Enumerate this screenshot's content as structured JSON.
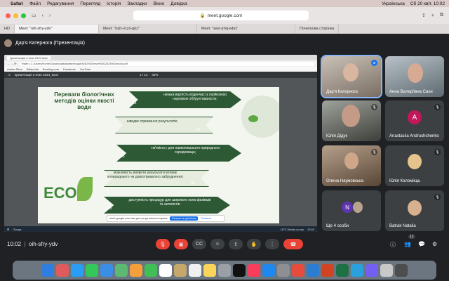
{
  "menubar": {
    "items": [
      "Safari",
      "Файл",
      "Редагування",
      "Перегляд",
      "Історія",
      "Закладки",
      "Вікно",
      "Довідка"
    ],
    "keyboard": "Українська",
    "datetime": "Сб 20 квіт.  10:02"
  },
  "browser": {
    "address": "meet.google.com",
    "tabs": [
      {
        "label": "HD",
        "active": false
      },
      {
        "label": "Meet: \"oih-sfry-ydv\"",
        "active": true
      },
      {
        "label": "Meet: \"hah-vczn-gkz\"",
        "active": false
      },
      {
        "label": "Meet: \"wwr-jrhq-wbq\"",
        "active": false
      },
      {
        "label": "Початкова сторінка",
        "active": false
      }
    ]
  },
  "meeting": {
    "presenter_title": "Дар'я Катернога (Презентація)",
    "code": "oih-sfry-ydv",
    "time": "10:02",
    "people_count": "12"
  },
  "shared_screen": {
    "window_tab": "презентація 2 етап 2024 екол",
    "file_path": "Файл  |  C:/Users/Home/Downloads/презентація%202%20етап%202024%20екол.pdf",
    "bookmarks": [
      "Adobe Sites",
      "Wikipedia",
      "Booking.com",
      "Facebook",
      "YouTube"
    ],
    "pdf_title": "презентація 2 етап 2024_екол",
    "pdf_page": "1 / 14",
    "pdf_zoom": "40%",
    "notice_text": "meet.google.com має доступ до вашого екрана",
    "notice_stop": "Більше не ділитися",
    "notice_hide": "Сховати",
    "taskbar_search": "Пошук",
    "taskbar_weather": "18°C  Mostly sunny",
    "taskbar_time": "10:02"
  },
  "slide": {
    "title": "Переваги біологічних методів оцінки якості води",
    "eco": "ECO",
    "items": [
      {
        "num": "01",
        "text": "низька вартість водночас із серйозною науковою обґрунтованістю;"
      },
      {
        "num": "02",
        "text": "швидке отримання результатів;"
      },
      {
        "num": "03",
        "text": "«м'якість» для навколишнього природного середовища;"
      },
      {
        "num": "04",
        "text": "можливість виявити результати впливу попереднього чи довготривалого забруднення;"
      },
      {
        "num": "05",
        "text": "доступність процедур для широкого кола фахівців та активістів"
      }
    ]
  },
  "participants": [
    {
      "name": "Дар'я Катернога",
      "kind": "photo",
      "speaking": true
    },
    {
      "name": "Анна Валеріївна Сахн",
      "kind": "photo"
    },
    {
      "name": "Юлія Дідук",
      "kind": "photo"
    },
    {
      "name": "Anastasiia Andrushchenko",
      "kind": "letter",
      "letter": "A"
    },
    {
      "name": "Олена Наумовська",
      "kind": "photo"
    },
    {
      "name": "Юлія Коломієць",
      "kind": "photo"
    },
    {
      "name": "Ще 4 особи",
      "kind": "letter",
      "letter": "N"
    },
    {
      "name": "Batrak Natalia",
      "kind": "photo"
    }
  ],
  "icons": [
    "apple-icon",
    "mic-off-icon",
    "camera-off-icon",
    "captions-icon",
    "emoji-icon",
    "present-icon",
    "raise-hand-icon",
    "more-icon",
    "hangup-icon",
    "info-icon",
    "people-icon",
    "chat-icon",
    "activities-icon",
    "lock-icon"
  ],
  "colors": {
    "accent_red": "#ea4335",
    "slide_green": "#2d5a35",
    "avatar_pink": "#c2185b",
    "avatar_purple": "#5e35b1"
  }
}
